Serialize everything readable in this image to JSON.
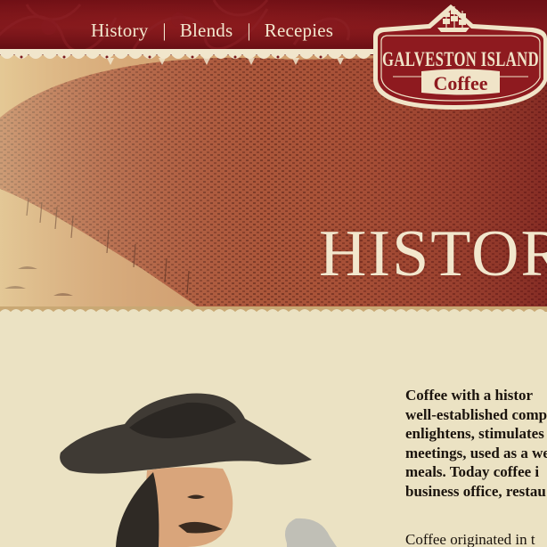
{
  "nav": {
    "items": [
      {
        "label": "History"
      },
      {
        "label": "Blends"
      },
      {
        "label": "Recepies"
      }
    ],
    "separator": "|"
  },
  "logo": {
    "line1": "GALVESTON ISLAND",
    "line2": "Coffee"
  },
  "hero": {
    "title": "HISTOR"
  },
  "content": {
    "intro_lines": [
      "Coffee with a histor",
      "well-established comp",
      "enlightens, stimulates",
      "meetings, used as a we",
      "meals. Today coffee i",
      "business office, restau"
    ],
    "second_paragraph_start": "Coffee originated in t"
  },
  "colors": {
    "maroon": "#6e0f15",
    "cream": "#ebe2c3",
    "text": "#1b140e"
  }
}
